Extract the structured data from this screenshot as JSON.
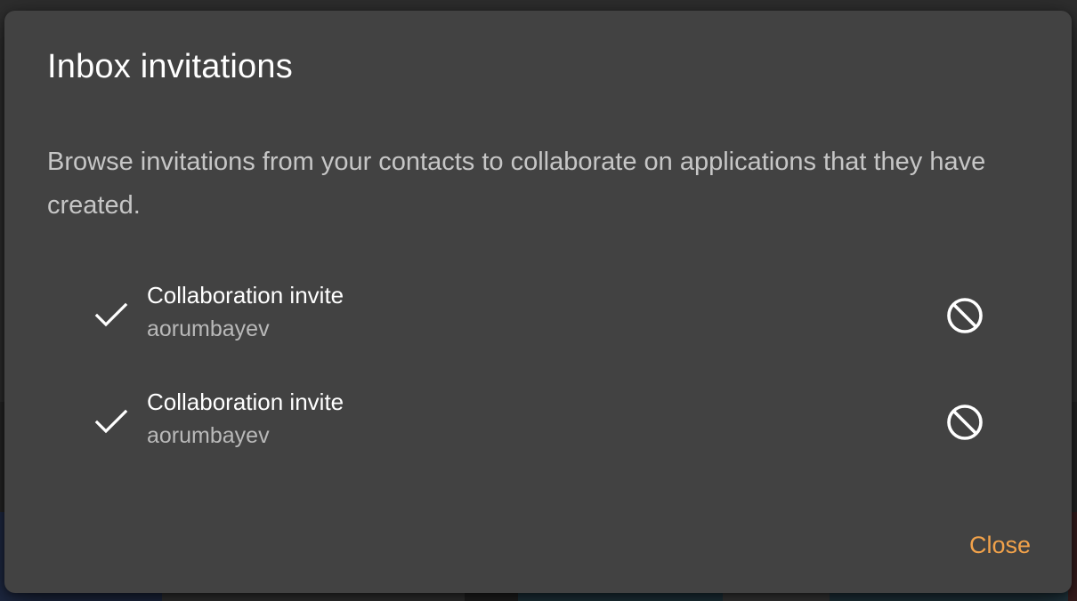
{
  "dialog": {
    "title": "Inbox invitations",
    "description": "Browse invitations from your contacts to collaborate on applications that they have created.",
    "close_label": "Close"
  },
  "invitations": [
    {
      "title": "Collaboration invite",
      "sender": "aorumbayev",
      "accept_icon": "check-icon",
      "decline_icon": "block-icon"
    },
    {
      "title": "Collaboration invite",
      "sender": "aorumbayev",
      "accept_icon": "check-icon",
      "decline_icon": "block-icon"
    }
  ],
  "colors": {
    "dialog_background": "#424242",
    "accent": "#f2a24a",
    "primary_text": "#ffffff",
    "secondary_text": "#c6c6c6"
  }
}
